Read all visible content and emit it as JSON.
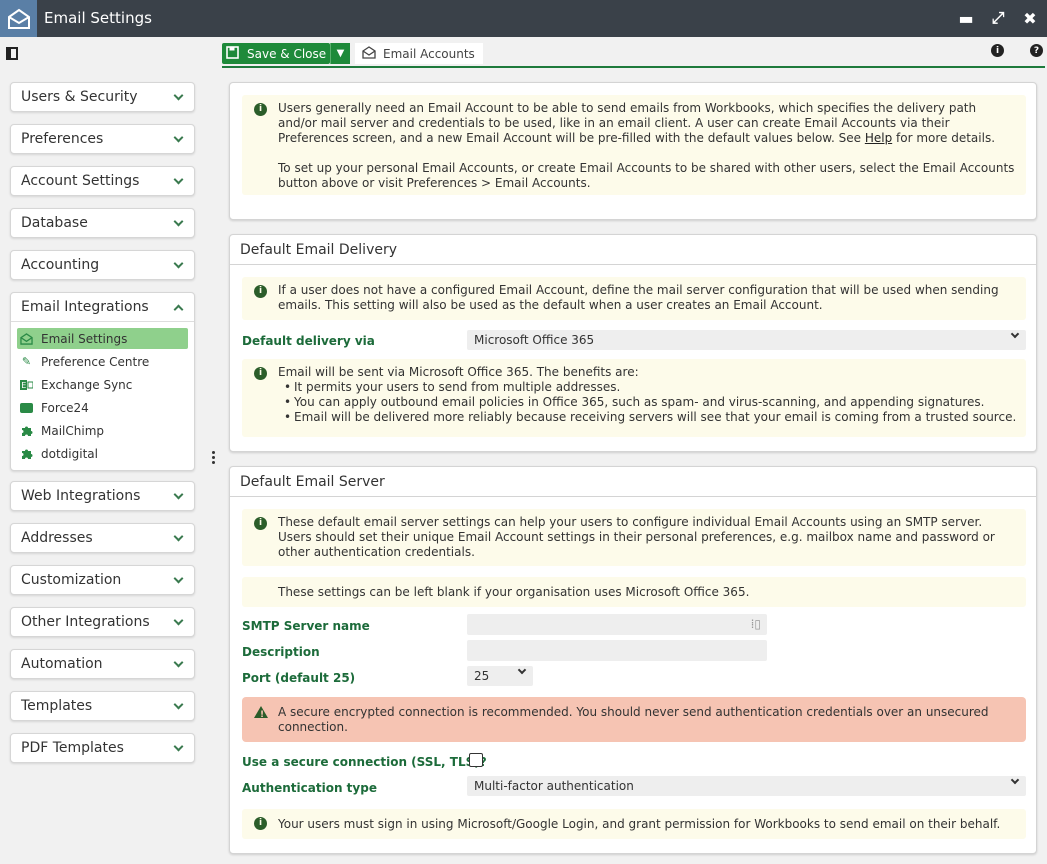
{
  "window": {
    "title": "Email Settings"
  },
  "toolbar": {
    "save_label": "Save & Close",
    "breadcrumb": "Email Accounts"
  },
  "nav": {
    "sections": [
      {
        "label": "Users & Security"
      },
      {
        "label": "Preferences"
      },
      {
        "label": "Account Settings"
      },
      {
        "label": "Database"
      },
      {
        "label": "Accounting"
      },
      {
        "label": "Email Integrations",
        "expanded": true
      },
      {
        "label": "Web Integrations"
      },
      {
        "label": "Addresses"
      },
      {
        "label": "Customization"
      },
      {
        "label": "Other Integrations"
      },
      {
        "label": "Automation"
      },
      {
        "label": "Templates"
      },
      {
        "label": "PDF Templates"
      }
    ],
    "email_items": [
      {
        "label": "Email Settings",
        "icon": "envelope-open-icon",
        "active": true
      },
      {
        "label": "Preference Centre",
        "icon": "edit-icon"
      },
      {
        "label": "Exchange Sync",
        "icon": "exchange-icon"
      },
      {
        "label": "Force24",
        "icon": "force24-icon"
      },
      {
        "label": "MailChimp",
        "icon": "puzzle-icon"
      },
      {
        "label": "dotdigital",
        "icon": "puzzle-icon"
      }
    ]
  },
  "intro": {
    "p1_before": "Users generally need an Email Account to be able to send emails from Workbooks, which specifies the delivery path and/or mail server and credentials to be used, like in an email client. A user can create Email Accounts via their Preferences screen, and a new Email Account will be pre-filled with the default values below. See ",
    "help_link": "Help",
    "p1_after": " for more details.",
    "p2": "To set up your personal Email Accounts, or create Email Accounts to be shared with other users, select the Email Accounts button above or visit Preferences > Email Accounts."
  },
  "delivery": {
    "title": "Default Email Delivery",
    "note": "If a user does not have a configured Email Account, define the mail server configuration that will be used when sending emails. This setting will also be used as the default when a user creates an Email Account.",
    "label": "Default delivery via",
    "value": "Microsoft Office 365",
    "benefits_intro": "Email will be sent via Microsoft Office 365. The benefits are:",
    "benefits": [
      "It permits your users to send from multiple addresses.",
      "You can apply outbound email policies in Office 365, such as spam- and virus-scanning, and appending signatures.",
      "Email will be delivered more reliably because receiving servers will see that your email is coming from a trusted source."
    ]
  },
  "server": {
    "title": "Default Email Server",
    "note": "These default email server settings can help your users to configure individual Email Accounts using an SMTP server. Users should set their unique Email Account settings in their personal preferences, e.g. mailbox name and password or other authentication credentials.",
    "note2": "These settings can be left blank if your organisation uses Microsoft Office 365.",
    "smtp_label": "SMTP Server name",
    "smtp_value": "",
    "desc_label": "Description",
    "desc_value": "",
    "port_label": "Port (default 25)",
    "port_value": "25",
    "warning": "A secure encrypted connection is recommended. You should never send authentication credentials over an unsecured connection.",
    "secure_label": "Use a secure connection (SSL, TLS)?",
    "secure_checked": false,
    "auth_label": "Authentication type",
    "auth_value": "Multi-factor authentication",
    "auth_note": "Your users must sign in using Microsoft/Google Login, and grant permission for Workbooks to send email on their behalf."
  },
  "colors": {
    "accent_green": "#1e8a3a",
    "titlebar": "#3a4149",
    "note_bg": "#fdfbea",
    "warning_bg": "#f6c4b3"
  }
}
